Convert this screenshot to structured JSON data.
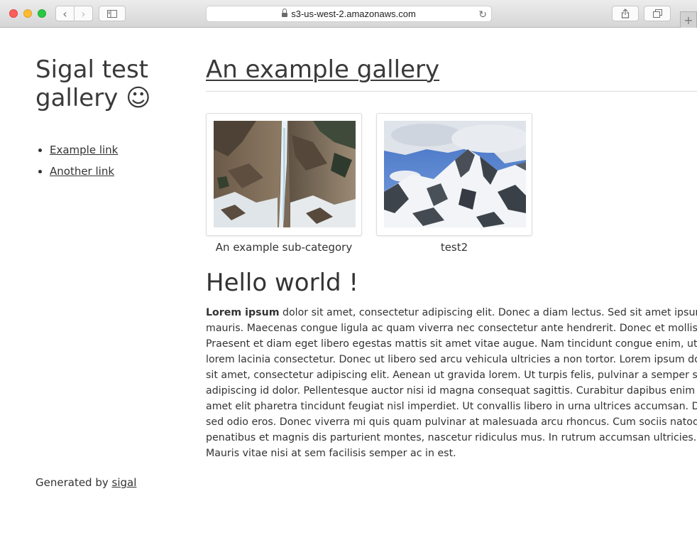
{
  "browser": {
    "url": "s3-us-west-2.amazonaws.com",
    "icons": [
      "close-window",
      "minimize-window",
      "zoom-window",
      "back-arrow",
      "forward-arrow",
      "sidebar",
      "lock",
      "reload",
      "share",
      "show-tabs",
      "new-tab"
    ]
  },
  "site": {
    "title": "Sigal test gallery ☺",
    "links": [
      {
        "label": "Example link"
      },
      {
        "label": "Another link"
      }
    ],
    "footer_prefix": "Generated by ",
    "footer_link": "sigal"
  },
  "gallery": {
    "title": "An example gallery",
    "albums": [
      {
        "caption": "An example sub-category"
      },
      {
        "caption": "test2"
      }
    ]
  },
  "content": {
    "heading": "Hello world !",
    "lead_bold": "Lorem ipsum",
    "lines": [
      " dolor sit amet, consectetur adipiscing elit. Donec a diam lectus. Sed sit amet ipsum",
      "mauris. Maecenas congue ligula ac quam viverra nec consectetur ante hendrerit. Donec et mollis dolor.",
      "Praesent et diam eget libero egestas mattis sit amet vitae augue. Nam tincidunt congue enim, ut porta",
      "lorem lacinia consectetur. Donec ut libero sed arcu vehicula ultricies a non tortor. Lorem ipsum dolor",
      "sit amet, consectetur adipiscing elit. Aenean ut gravida lorem. Ut turpis felis, pulvinar a semper sed,",
      "adipiscing id dolor. Pellentesque auctor nisi id magna consequat sagittis. Curabitur dapibus enim sit",
      "amet elit pharetra tincidunt feugiat nisl imperdiet. Ut convallis libero in urna ultrices accumsan. Donec",
      "sed odio eros. Donec viverra mi quis quam pulvinar at malesuada arcu rhoncus. Cum sociis natoque",
      "penatibus et magnis dis parturient montes, nascetur ridiculus mus. In rutrum accumsan ultricies.",
      "Mauris vitae nisi at sem facilisis semper ac in est."
    ]
  }
}
